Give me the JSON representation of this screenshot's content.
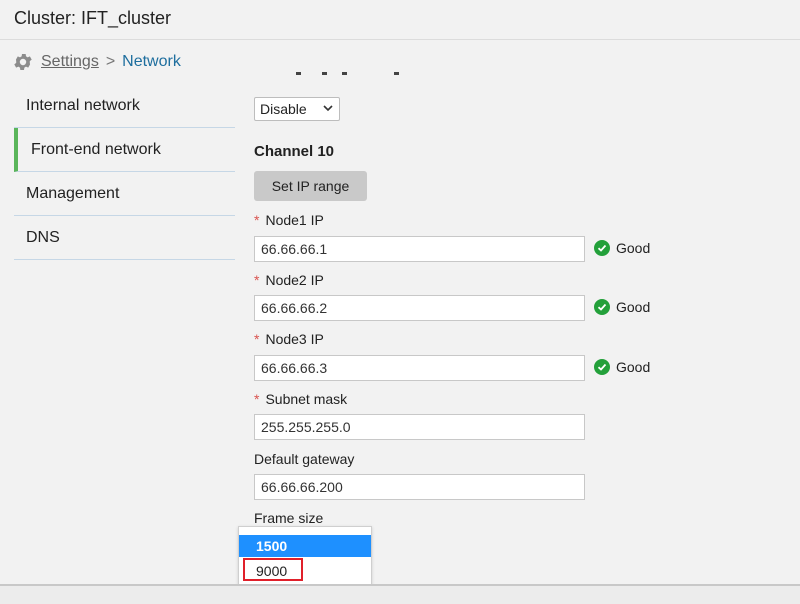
{
  "window": {
    "title": "Cluster: IFT_cluster"
  },
  "breadcrumb": {
    "root": "Settings",
    "separator": ">",
    "current": "Network"
  },
  "sidebar": {
    "items": [
      {
        "label": "Internal network",
        "active": false
      },
      {
        "label": "Front-end network",
        "active": true
      },
      {
        "label": "Management",
        "active": false
      },
      {
        "label": "DNS",
        "active": false
      }
    ],
    "active_accent_color": "#5ab55a"
  },
  "form": {
    "mode_select": {
      "value": "Disable"
    },
    "channel_heading": "Channel 10",
    "set_ip_button": "Set IP range",
    "required_marker": "*",
    "fields": [
      {
        "label": "Node1 IP",
        "required": true,
        "value": "66.66.66.1",
        "status": "Good"
      },
      {
        "label": "Node2 IP",
        "required": true,
        "value": "66.66.66.2",
        "status": "Good"
      },
      {
        "label": "Node3 IP",
        "required": true,
        "value": "66.66.66.3",
        "status": "Good"
      },
      {
        "label": "Subnet mask",
        "required": true,
        "value": "255.255.255.0"
      },
      {
        "label": "Default gateway",
        "required": false,
        "value": "66.66.66.200"
      }
    ],
    "frame_size": {
      "label": "Frame size",
      "options": [
        "1500",
        "9000"
      ],
      "selected": "1500",
      "highlighted": "9000"
    }
  },
  "colors": {
    "status_good": "#23a03a",
    "required": "#d9534f",
    "link": "#1e6e9e",
    "dropdown_selected": "#1e90ff",
    "highlight_box": "#e0202a"
  },
  "icons": {
    "settings": "gear-icon",
    "status_ok": "check-circle-icon",
    "select_caret": "chevron-down-icon"
  }
}
